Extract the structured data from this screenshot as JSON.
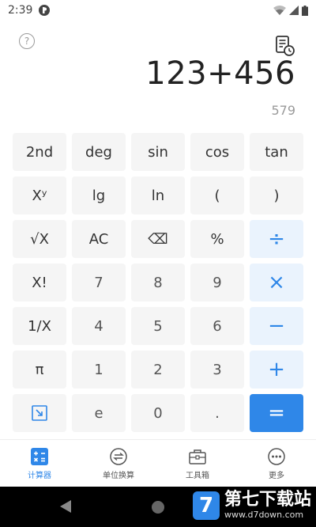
{
  "status_bar": {
    "time": "2:39"
  },
  "display": {
    "expression": "123+456",
    "result": "579"
  },
  "keypad": {
    "keys": [
      {
        "label": "2nd",
        "name": "key-2nd",
        "kind": "fn"
      },
      {
        "label": "deg",
        "name": "key-deg",
        "kind": "fn"
      },
      {
        "label": "sin",
        "name": "key-sin",
        "kind": "fn"
      },
      {
        "label": "cos",
        "name": "key-cos",
        "kind": "fn"
      },
      {
        "label": "tan",
        "name": "key-tan",
        "kind": "fn"
      },
      {
        "label": "Xʸ",
        "name": "key-power",
        "kind": "fn"
      },
      {
        "label": "lg",
        "name": "key-lg",
        "kind": "fn"
      },
      {
        "label": "ln",
        "name": "key-ln",
        "kind": "fn"
      },
      {
        "label": "(",
        "name": "key-open-paren",
        "kind": "fn"
      },
      {
        "label": ")",
        "name": "key-close-paren",
        "kind": "fn"
      },
      {
        "label": "√X",
        "name": "key-sqrt",
        "kind": "fn"
      },
      {
        "label": "AC",
        "name": "key-clear",
        "kind": "fn"
      },
      {
        "label": "⌫",
        "name": "key-backspace",
        "kind": "fn"
      },
      {
        "label": "%",
        "name": "key-percent",
        "kind": "fn"
      },
      {
        "label": "÷",
        "name": "key-divide",
        "kind": "op"
      },
      {
        "label": "X!",
        "name": "key-factorial",
        "kind": "fn"
      },
      {
        "label": "7",
        "name": "key-7",
        "kind": "num"
      },
      {
        "label": "8",
        "name": "key-8",
        "kind": "num"
      },
      {
        "label": "9",
        "name": "key-9",
        "kind": "num"
      },
      {
        "label": "×",
        "name": "key-multiply",
        "kind": "op"
      },
      {
        "label": "1/X",
        "name": "key-reciprocal",
        "kind": "fn"
      },
      {
        "label": "4",
        "name": "key-4",
        "kind": "num"
      },
      {
        "label": "5",
        "name": "key-5",
        "kind": "num"
      },
      {
        "label": "6",
        "name": "key-6",
        "kind": "num"
      },
      {
        "label": "−",
        "name": "key-minus",
        "kind": "op"
      },
      {
        "label": "π",
        "name": "key-pi",
        "kind": "fn"
      },
      {
        "label": "1",
        "name": "key-1",
        "kind": "num"
      },
      {
        "label": "2",
        "name": "key-2",
        "kind": "num"
      },
      {
        "label": "3",
        "name": "key-3",
        "kind": "num"
      },
      {
        "label": "+",
        "name": "key-plus",
        "kind": "op"
      },
      {
        "label": "↘",
        "name": "key-collapse",
        "kind": "icon"
      },
      {
        "label": "e",
        "name": "key-e",
        "kind": "num"
      },
      {
        "label": "0",
        "name": "key-0",
        "kind": "num"
      },
      {
        "label": ".",
        "name": "key-decimal",
        "kind": "num"
      },
      {
        "label": "=",
        "name": "key-equals",
        "kind": "eq"
      }
    ]
  },
  "bottom_nav": {
    "items": [
      {
        "label": "计算器",
        "icon": "calculator-icon",
        "active": true
      },
      {
        "label": "单位换算",
        "icon": "exchange-icon",
        "active": false
      },
      {
        "label": "工具箱",
        "icon": "toolbox-icon",
        "active": false
      },
      {
        "label": "更多",
        "icon": "more-icon",
        "active": false
      }
    ]
  },
  "watermark": {
    "title": "第七下载站",
    "url": "www.d7down.com",
    "logo": "7"
  },
  "colors": {
    "accent": "#2f87e8",
    "key_bg": "#f5f5f5",
    "op_bg": "#eaf3fd"
  }
}
